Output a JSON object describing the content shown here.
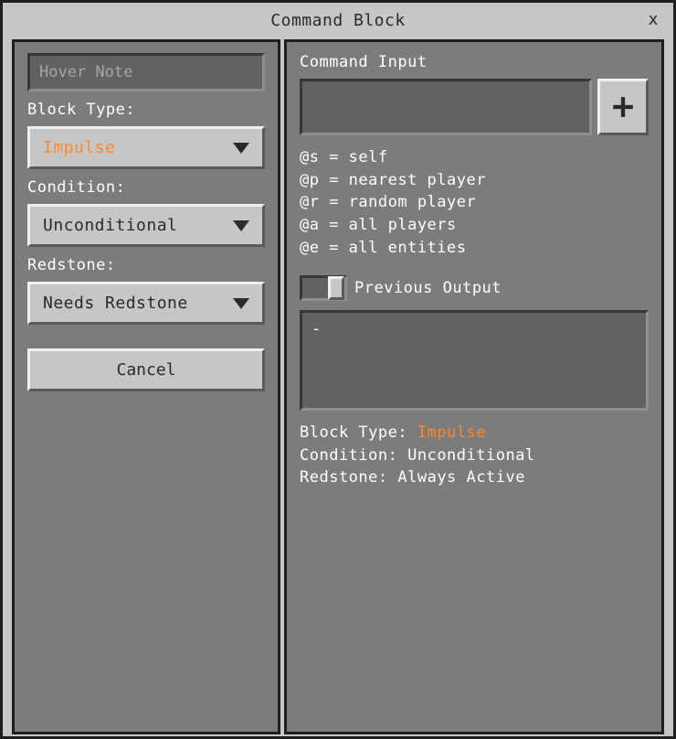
{
  "window": {
    "title": "Command Block"
  },
  "left": {
    "hover_note_placeholder": "Hover Note",
    "block_type_label": "Block Type:",
    "block_type_value": "Impulse",
    "condition_label": "Condition:",
    "condition_value": "Unconditional",
    "redstone_label": "Redstone:",
    "redstone_value": "Needs Redstone",
    "cancel_label": "Cancel"
  },
  "right": {
    "command_input_label": "Command Input",
    "command_input_value": "",
    "help_lines": [
      "@s = self",
      "@p = nearest player",
      "@r = random player",
      "@a = all players",
      "@e = all entities"
    ],
    "previous_output_label": "Previous Output",
    "previous_output_value": "-",
    "summary": {
      "block_type_label": "Block Type:",
      "block_type_value": "Impulse",
      "condition_label": "Condition:",
      "condition_value": "Unconditional",
      "redstone_label": "Redstone:",
      "redstone_value": "Always Active"
    }
  }
}
